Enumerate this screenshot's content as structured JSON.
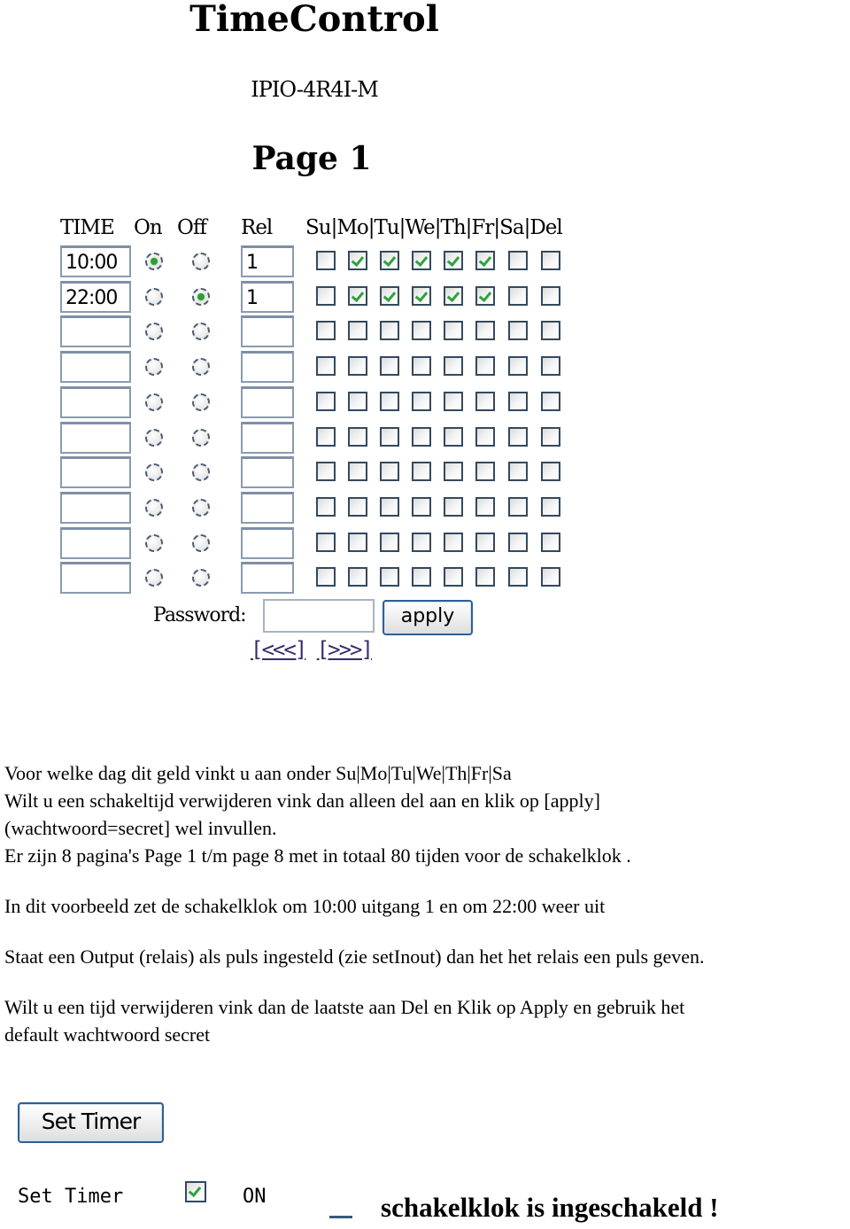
{
  "header": {
    "title": "TimeControl",
    "device": "IPIO-4R4I-M",
    "page_label": "Page 1"
  },
  "table": {
    "columns": {
      "time": "TIME",
      "on": "On",
      "off": "Off",
      "rel": "Rel",
      "days": "Su|Mo|Tu|We|Th|Fr|Sa|Del"
    },
    "day_keys": [
      "Su",
      "Mo",
      "Tu",
      "We",
      "Th",
      "Fr",
      "Sa",
      "Del"
    ],
    "rows": [
      {
        "time": "10:00",
        "state": "on",
        "rel": "1",
        "days": [
          false,
          true,
          true,
          true,
          true,
          true,
          false,
          false
        ]
      },
      {
        "time": "22:00",
        "state": "off",
        "rel": "1",
        "days": [
          false,
          true,
          true,
          true,
          true,
          true,
          false,
          false
        ]
      },
      {
        "time": "",
        "state": "",
        "rel": "",
        "days": [
          false,
          false,
          false,
          false,
          false,
          false,
          false,
          false
        ]
      },
      {
        "time": "",
        "state": "",
        "rel": "",
        "days": [
          false,
          false,
          false,
          false,
          false,
          false,
          false,
          false
        ]
      },
      {
        "time": "",
        "state": "",
        "rel": "",
        "days": [
          false,
          false,
          false,
          false,
          false,
          false,
          false,
          false
        ]
      },
      {
        "time": "",
        "state": "",
        "rel": "",
        "days": [
          false,
          false,
          false,
          false,
          false,
          false,
          false,
          false
        ]
      },
      {
        "time": "",
        "state": "",
        "rel": "",
        "days": [
          false,
          false,
          false,
          false,
          false,
          false,
          false,
          false
        ]
      },
      {
        "time": "",
        "state": "",
        "rel": "",
        "days": [
          false,
          false,
          false,
          false,
          false,
          false,
          false,
          false
        ]
      },
      {
        "time": "",
        "state": "",
        "rel": "",
        "days": [
          false,
          false,
          false,
          false,
          false,
          false,
          false,
          false
        ]
      },
      {
        "time": "",
        "state": "",
        "rel": "",
        "days": [
          false,
          false,
          false,
          false,
          false,
          false,
          false,
          false
        ]
      }
    ]
  },
  "form": {
    "password_label": "Password:",
    "password_value": "",
    "apply_label": "apply",
    "prev_link": "[<<<]",
    "next_link": "[>>>]"
  },
  "instructions": {
    "lines": [
      "Voor welke dag dit geld vinkt u aan onder Su|Mo|Tu|We|Th|Fr|Sa",
      "Wilt u een schakeltijd verwijderen vink dan alleen del aan en klik op [apply]",
      "(wachtwoord=secret] wel invullen.",
      "Er zijn 8 pagina's Page 1 t/m page 8 met in totaal 80 tijden voor de schakelklok .",
      "In dit voorbeeld zet de schakelklok om 10:00  uitgang 1 en om 22:00 weer uit",
      "Staat een Output (relais) als puls ingesteld (zie setInout) dan het het relais een puls geven.",
      "Wilt u een tijd verwijderen vink dan de laatste aan Del en  Klik op Apply  en gebruik het",
      "default wachtwoord secret"
    ]
  },
  "set_timer": {
    "button_label": "Set Timer",
    "label": "Set Timer",
    "checked": true,
    "state_text": "ON",
    "status_message": "schakelklok is ingeschakeld !"
  }
}
